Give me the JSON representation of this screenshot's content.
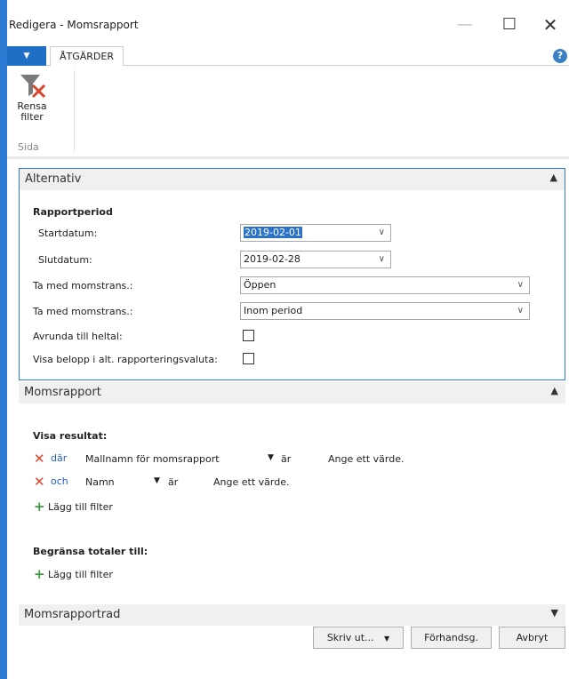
{
  "window": {
    "title": "Redigera - Momsrapport",
    "minimize_glyph": "—",
    "maximize_glyph": "☐",
    "close_glyph": "✕"
  },
  "ribbon": {
    "app_menu_glyph": "▼",
    "tab_label": "ÅTGÄRDER",
    "help_glyph": "?",
    "clear_filter_label": "Rensa filter",
    "group_label": "Sida"
  },
  "alternativ": {
    "title": "Alternativ",
    "collapse_glyph": "▲",
    "period_heading": "Rapportperiod",
    "start_label": "Startdatum:",
    "start_value": "2019-02-01",
    "end_label": "Slutdatum:",
    "end_value": "2019-02-28",
    "include1_label": "Ta med momstrans.:",
    "include1_value": "Öppen",
    "include2_label": "Ta med momstrans.:",
    "include2_value": "Inom period",
    "round_label": "Avrunda till heltal:",
    "round_checked": false,
    "currency_label": "Visa belopp i alt. rapporteringsvaluta:",
    "currency_checked": false,
    "dropdown_glyph": "∨"
  },
  "momsrapport": {
    "title": "Momsrapport",
    "collapse_glyph": "▲",
    "results_heading": "Visa resultat:",
    "filters": [
      {
        "connector": "där",
        "field": "Mallnamn för momsrapport",
        "op": "är",
        "value": "Ange ett värde."
      },
      {
        "connector": "och",
        "field": "Namn",
        "op": "är",
        "value": "Ange ett värde."
      }
    ],
    "remove_glyph": "✕",
    "field_dropdown_glyph": "▼",
    "add_filter_glyph": "+",
    "add_filter_label": "Lägg till filter",
    "totals_heading": "Begränsa totaler till:",
    "add_filter_label_2": "Lägg till filter"
  },
  "momsrapportrad": {
    "title": "Momsrapportrad",
    "expand_glyph": "▼"
  },
  "footer": {
    "print_label": "Skriv ut...",
    "print_dropdown_glyph": "▼",
    "preview_label": "Förhandsg.",
    "cancel_label": "Avbryt"
  },
  "colors": {
    "accent": "#2b7bd3",
    "remove": "#d9452b",
    "add": "#3a9b3a",
    "link": "#1f5fbf"
  }
}
